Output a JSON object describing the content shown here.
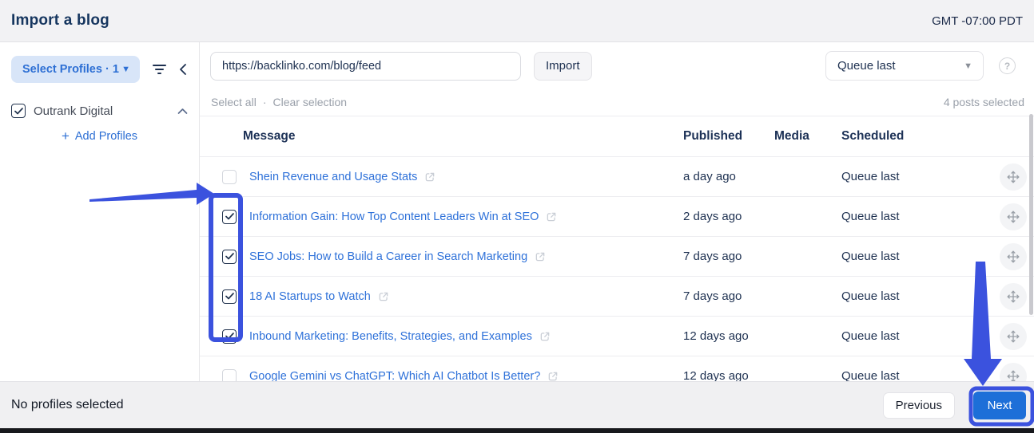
{
  "header": {
    "title": "Import a blog",
    "timezone": "GMT -07:00 PDT"
  },
  "sidebar": {
    "select_profiles_label": "Select Profiles · 1",
    "profile_group": {
      "name": "Outrank Digital",
      "checked": true
    },
    "add_profiles_label": "Add Profiles",
    "plus_glyph": "+"
  },
  "toolbar": {
    "feed_url": "https://backlinko.com/blog/feed",
    "import_label": "Import",
    "queue_select_value": "Queue last"
  },
  "selection_bar": {
    "select_all_label": "Select all",
    "separator": "·",
    "clear_selection_label": "Clear selection",
    "selected_count_label": "4 posts selected"
  },
  "table": {
    "columns": [
      "Message",
      "Published",
      "Media",
      "Scheduled"
    ],
    "rows": [
      {
        "title": "Shein Revenue and Usage Stats",
        "published": "a day ago",
        "scheduled": "Queue last",
        "checked": false
      },
      {
        "title": "Information Gain: How Top Content Leaders Win at SEO",
        "published": "2 days ago",
        "scheduled": "Queue last",
        "checked": true
      },
      {
        "title": "SEO Jobs: How to Build a Career in Search Marketing",
        "published": "7 days ago",
        "scheduled": "Queue last",
        "checked": true
      },
      {
        "title": "18 AI Startups to Watch",
        "published": "7 days ago",
        "scheduled": "Queue last",
        "checked": true
      },
      {
        "title": "Inbound Marketing: Benefits, Strategies, and Examples",
        "published": "12 days ago",
        "scheduled": "Queue last",
        "checked": true
      },
      {
        "title": "Google Gemini vs ChatGPT: Which AI Chatbot Is Better?",
        "published": "12 days ago",
        "scheduled": "Queue last",
        "checked": false
      }
    ]
  },
  "footer": {
    "status": "No profiles selected",
    "previous_label": "Previous",
    "next_label": "Next"
  },
  "colors": {
    "link_blue": "#2e71d9",
    "annotation_blue": "#3b52de",
    "next_button_blue": "#1d6fd8",
    "dark_navy": "#1d3050",
    "selected_pill_bg": "#d8e5f8"
  }
}
